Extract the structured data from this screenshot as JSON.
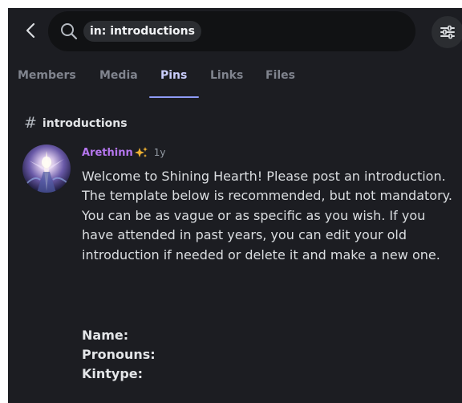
{
  "search": {
    "query": "in: introductions"
  },
  "tabs": [
    {
      "label": "Members"
    },
    {
      "label": "Media"
    },
    {
      "label": "Pins"
    },
    {
      "label": "Links"
    },
    {
      "label": "Files"
    }
  ],
  "active_tab": "Pins",
  "channel": {
    "name": "introductions"
  },
  "message": {
    "author": "Arethinn",
    "timestamp": "1y",
    "body": "Welcome to Shining Hearth! Please post an introduction. The template below is recommended, but not mandatory. You can be as vague or as specific as you wish. If you have attended in past years, you can edit your old introduction if needed or delete it and make a new one.",
    "fields": [
      "Name:",
      "Pronouns:",
      "Kintype:"
    ]
  },
  "colors": {
    "background": "#1c1d22",
    "search_background": "#111214",
    "active_tab": "#c9cdfb",
    "tab_underline": "#8e9bf6",
    "username": "#b576ee",
    "sparkle": "#f0b232"
  },
  "icons": {
    "back": "chevron-left-icon",
    "search": "search-icon",
    "filter": "sliders-icon",
    "channel": "hash-icon",
    "author_badge": "sparkle-icon"
  }
}
